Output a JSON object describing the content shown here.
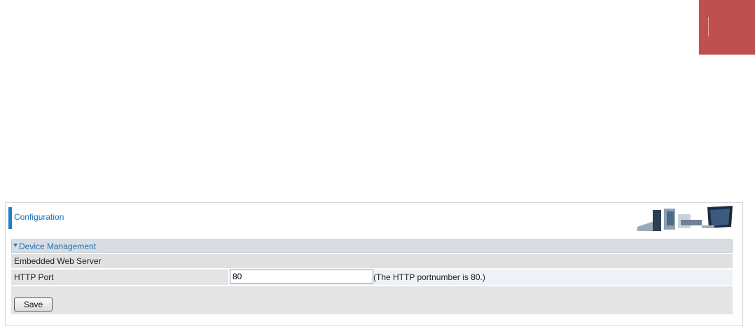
{
  "panel": {
    "title": "Configuration"
  },
  "section": {
    "title": "Device Management",
    "subsection_label": "Embedded Web Server",
    "http_port": {
      "label": "HTTP Port",
      "value": "80",
      "hint": "(The HTTP portnumber is 80.)"
    },
    "save_label": "Save"
  },
  "colors": {
    "accent": "#1f7fc4",
    "corner_block": "#c0504d"
  }
}
